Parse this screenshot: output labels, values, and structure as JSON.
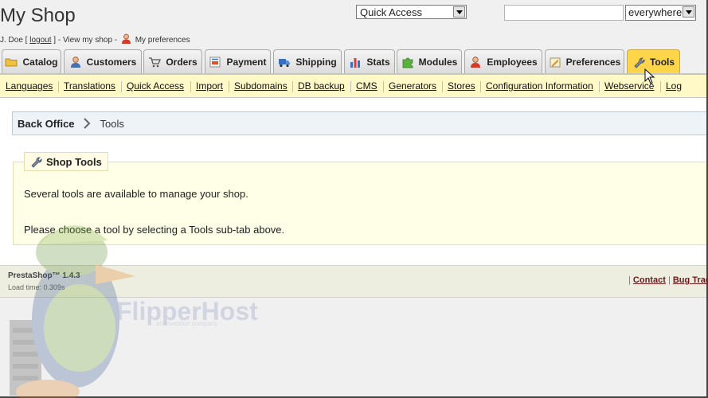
{
  "header": {
    "shop_title": "My Shop",
    "user_name": "J. Doe [",
    "logout_label": "logout",
    "after_logout": "] - View my shop -",
    "preferences_label": "My preferences",
    "quick_access": "Quick Access",
    "search_value": "",
    "search_scope": "everywhere"
  },
  "tabs": [
    {
      "label": "Catalog",
      "icon": "folder-icon"
    },
    {
      "label": "Customers",
      "icon": "customer-icon"
    },
    {
      "label": "Orders",
      "icon": "cart-icon"
    },
    {
      "label": "Payment",
      "icon": "payment-icon"
    },
    {
      "label": "Shipping",
      "icon": "truck-icon"
    },
    {
      "label": "Stats",
      "icon": "bar-chart-icon"
    },
    {
      "label": "Modules",
      "icon": "puzzle-icon"
    },
    {
      "label": "Employees",
      "icon": "employee-icon"
    },
    {
      "label": "Preferences",
      "icon": "preferences-icon"
    },
    {
      "label": "Tools",
      "icon": "wrench-icon",
      "active": true
    }
  ],
  "subtabs": [
    "Languages",
    "Translations",
    "Quick Access",
    "Import",
    "Subdomains",
    "DB backup",
    "CMS",
    "Generators",
    "Stores",
    "Configuration Information",
    "Webservice",
    "Log"
  ],
  "breadcrumb": {
    "root": "Back Office",
    "current": "Tools"
  },
  "panel": {
    "title": "Shop Tools",
    "line1": "Several tools are available to manage your shop.",
    "line2": "Please choose a tool by selecting a Tools sub-tab above."
  },
  "footer": {
    "version": "PrestaShop™ 1.4.3",
    "load_time": "Load time: 0.309s",
    "sep": "|",
    "contact": "Contact",
    "bug_tracker": "Bug Trac"
  },
  "watermark": {
    "brand": "FlipperHost",
    "tagline": "an investion company"
  },
  "colors": {
    "active_tab": "#ffd54a",
    "subtab_bar": "#fff8c7",
    "panel_bg": "#ffffe8"
  }
}
